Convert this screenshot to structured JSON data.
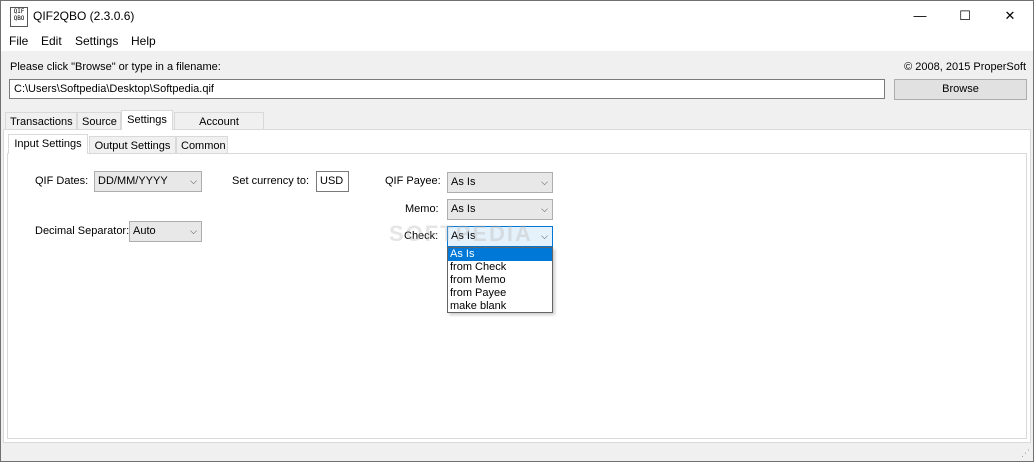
{
  "window": {
    "title": "QIF2QBO (2.3.0.6)",
    "app_icon_text": "QIF\nQBO",
    "minimize": "—",
    "maximize": "☐",
    "close": "✕"
  },
  "menu": [
    "File",
    "Edit",
    "Settings",
    "Help"
  ],
  "header": {
    "prompt": "Please click \"Browse\" or type in a filename:",
    "copyright": "© 2008, 2015 ProperSoft",
    "file_value": "C:\\Users\\Softpedia\\Desktop\\Softpedia.qif",
    "browse_label": "Browse"
  },
  "tabs": [
    "Transactions",
    "Source",
    "Settings",
    "Account Mapping"
  ],
  "subtabs": [
    "Input Settings",
    "Output Settings",
    "Common"
  ],
  "form": {
    "qif_dates_label": "QIF Dates:",
    "qif_dates_value": "DD/MM/YYYY",
    "decimal_label": "Decimal Separator:",
    "decimal_value": "Auto",
    "currency_label": "Set currency to:",
    "currency_value": "USD",
    "payee_label": "QIF Payee:",
    "payee_value": "As Is",
    "memo_label": "Memo:",
    "memo_value": "As Is",
    "check_label": "Check:",
    "check_value": "As Is",
    "check_options": [
      "As Is",
      "from Check",
      "from Memo",
      "from Payee",
      "make blank"
    ]
  },
  "watermark": "SOFTPEDIA",
  "icons": {
    "dropdown": "chevron-down-icon"
  },
  "colors": {
    "selection": "#0078d7",
    "focus_border": "#0078d7"
  }
}
